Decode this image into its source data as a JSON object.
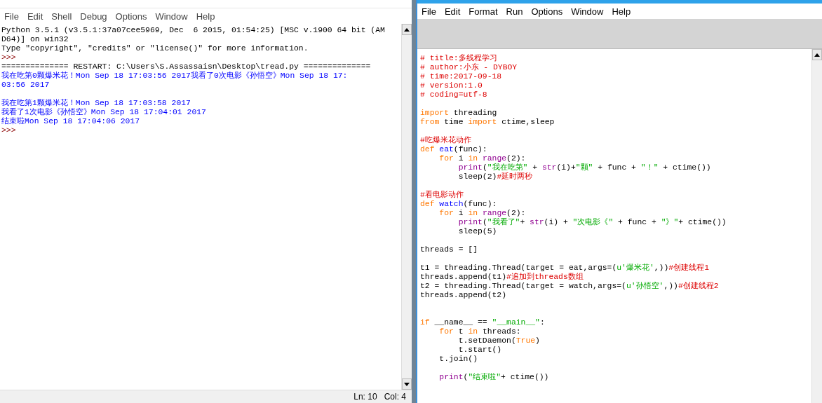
{
  "shell": {
    "menu": [
      "File",
      "Edit",
      "Shell",
      "Debug",
      "Options",
      "Window",
      "Help"
    ],
    "lines": [
      {
        "kind": "plain",
        "text": "Python 3.5.1 (v3.5.1:37a07cee5969, Dec  6 2015, 01:54:25) [MSC v.1900 64 bit (AM"
      },
      {
        "kind": "plain",
        "text": "D64)] on win32"
      },
      {
        "kind": "plain",
        "text": "Type \"copyright\", \"credits\" or \"license()\" for more information."
      },
      {
        "kind": "prompt",
        "text": ">>>"
      },
      {
        "kind": "plain",
        "text": "============== RESTART: C:\\Users\\S.Assassaisn\\Desktop\\tread.py =============="
      },
      {
        "kind": "stdout",
        "text": "我在吃第0颗爆米花！Mon Sep 18 17:03:56 2017我看了0次电影《孙悟空》Mon Sep 18 17:"
      },
      {
        "kind": "stdout",
        "text": "03:56 2017"
      },
      {
        "kind": "blank"
      },
      {
        "kind": "stdout",
        "text": "我在吃第1颗爆米花！Mon Sep 18 17:03:58 2017"
      },
      {
        "kind": "stdout",
        "text": "我看了1次电影《孙悟空》Mon Sep 18 17:04:01 2017"
      },
      {
        "kind": "stdout",
        "text": "结束啦Mon Sep 18 17:04:06 2017"
      },
      {
        "kind": "prompt",
        "text": ">>>"
      }
    ],
    "status_bar": {
      "line": "Ln: 10",
      "column": "Col: 4"
    }
  },
  "editor": {
    "menu": [
      "File",
      "Edit",
      "Format",
      "Run",
      "Options",
      "Window",
      "Help"
    ],
    "lines": [
      {
        "kind": "code",
        "tokens": [
          {
            "kind": "comment",
            "text": "# title:多线程学习"
          }
        ]
      },
      {
        "kind": "code",
        "tokens": [
          {
            "kind": "comment",
            "text": "# author:小东 - DYBOY"
          }
        ]
      },
      {
        "kind": "code",
        "tokens": [
          {
            "kind": "comment",
            "text": "# time:2017-09-18"
          }
        ]
      },
      {
        "kind": "code",
        "tokens": [
          {
            "kind": "comment",
            "text": "# version:1.0"
          }
        ]
      },
      {
        "kind": "code",
        "tokens": [
          {
            "kind": "comment",
            "text": "# coding=utf-8"
          }
        ]
      },
      {
        "kind": "blank"
      },
      {
        "kind": "code",
        "tokens": [
          {
            "kind": "keyword",
            "text": "import"
          },
          {
            "kind": "plain",
            "text": " threading"
          }
        ]
      },
      {
        "kind": "code",
        "tokens": [
          {
            "kind": "keyword",
            "text": "from"
          },
          {
            "kind": "plain",
            "text": " time "
          },
          {
            "kind": "keyword",
            "text": "import"
          },
          {
            "kind": "plain",
            "text": " ctime,sleep"
          }
        ]
      },
      {
        "kind": "blank"
      },
      {
        "kind": "code",
        "tokens": [
          {
            "kind": "comment",
            "text": "#吃爆米花动作"
          }
        ]
      },
      {
        "kind": "code",
        "tokens": [
          {
            "kind": "keyword",
            "text": "def "
          },
          {
            "kind": "definition",
            "text": "eat"
          },
          {
            "kind": "plain",
            "text": "(func):"
          }
        ]
      },
      {
        "kind": "code",
        "tokens": [
          {
            "kind": "keyword",
            "text": "    for"
          },
          {
            "kind": "plain",
            "text": " i "
          },
          {
            "kind": "keyword",
            "text": "in "
          },
          {
            "kind": "builtin",
            "text": "range"
          },
          {
            "kind": "plain",
            "text": "(2):"
          }
        ]
      },
      {
        "kind": "code",
        "tokens": [
          {
            "kind": "builtin",
            "text": "        print"
          },
          {
            "kind": "plain",
            "text": "("
          },
          {
            "kind": "string",
            "text": "\"我在吃第\""
          },
          {
            "kind": "plain",
            "text": " + "
          },
          {
            "kind": "builtin",
            "text": "str"
          },
          {
            "kind": "plain",
            "text": "(i)+"
          },
          {
            "kind": "string",
            "text": "\"颗\""
          },
          {
            "kind": "plain",
            "text": " + func + "
          },
          {
            "kind": "string",
            "text": "\"！\""
          },
          {
            "kind": "plain",
            "text": " + ctime())"
          }
        ]
      },
      {
        "kind": "code",
        "tokens": [
          {
            "kind": "plain",
            "text": "        sleep(2)"
          },
          {
            "kind": "comment",
            "text": "#延时两秒"
          }
        ]
      },
      {
        "kind": "blank"
      },
      {
        "kind": "code",
        "tokens": [
          {
            "kind": "comment",
            "text": "#看电影动作"
          }
        ]
      },
      {
        "kind": "code",
        "tokens": [
          {
            "kind": "keyword",
            "text": "def "
          },
          {
            "kind": "definition",
            "text": "watch"
          },
          {
            "kind": "plain",
            "text": "(func):"
          }
        ]
      },
      {
        "kind": "code",
        "tokens": [
          {
            "kind": "keyword",
            "text": "    for"
          },
          {
            "kind": "plain",
            "text": " i "
          },
          {
            "kind": "keyword",
            "text": "in "
          },
          {
            "kind": "builtin",
            "text": "range"
          },
          {
            "kind": "plain",
            "text": "(2):"
          }
        ]
      },
      {
        "kind": "code",
        "tokens": [
          {
            "kind": "builtin",
            "text": "        print"
          },
          {
            "kind": "plain",
            "text": "("
          },
          {
            "kind": "string",
            "text": "\"我看了\""
          },
          {
            "kind": "plain",
            "text": "+ "
          },
          {
            "kind": "builtin",
            "text": "str"
          },
          {
            "kind": "plain",
            "text": "(i) + "
          },
          {
            "kind": "string",
            "text": "\"次电影《\""
          },
          {
            "kind": "plain",
            "text": " + func + "
          },
          {
            "kind": "string",
            "text": "\"》\""
          },
          {
            "kind": "plain",
            "text": "+ ctime())"
          }
        ]
      },
      {
        "kind": "code",
        "tokens": [
          {
            "kind": "plain",
            "text": "        sleep(5)"
          }
        ]
      },
      {
        "kind": "blank"
      },
      {
        "kind": "code",
        "tokens": [
          {
            "kind": "plain",
            "text": "threads = []"
          }
        ]
      },
      {
        "kind": "blank"
      },
      {
        "kind": "code",
        "tokens": [
          {
            "kind": "plain",
            "text": "t1 = threading.Thread(target = eat,args=("
          },
          {
            "kind": "string",
            "text": "u'爆米花'"
          },
          {
            "kind": "plain",
            "text": ",))"
          },
          {
            "kind": "comment",
            "text": "#创建线程1"
          }
        ]
      },
      {
        "kind": "code",
        "tokens": [
          {
            "kind": "plain",
            "text": "threads.append(t1)"
          },
          {
            "kind": "comment",
            "text": "#追加到threads数组"
          }
        ]
      },
      {
        "kind": "code",
        "tokens": [
          {
            "kind": "plain",
            "text": "t2 = threading.Thread(target = watch,args=("
          },
          {
            "kind": "string",
            "text": "u'孙悟空'"
          },
          {
            "kind": "plain",
            "text": ",))"
          },
          {
            "kind": "comment",
            "text": "#创建线程2"
          }
        ]
      },
      {
        "kind": "code",
        "tokens": [
          {
            "kind": "plain",
            "text": "threads.append(t2)"
          }
        ]
      },
      {
        "kind": "blank"
      },
      {
        "kind": "blank"
      },
      {
        "kind": "code",
        "tokens": [
          {
            "kind": "keyword",
            "text": "if"
          },
          {
            "kind": "plain",
            "text": " __name__ == "
          },
          {
            "kind": "string",
            "text": "\"__main__\""
          },
          {
            "kind": "plain",
            "text": ":"
          }
        ]
      },
      {
        "kind": "code",
        "tokens": [
          {
            "kind": "keyword",
            "text": "    for"
          },
          {
            "kind": "plain",
            "text": " t "
          },
          {
            "kind": "keyword",
            "text": "in"
          },
          {
            "kind": "plain",
            "text": " threads:"
          }
        ]
      },
      {
        "kind": "code",
        "tokens": [
          {
            "kind": "plain",
            "text": "        t.setDaemon("
          },
          {
            "kind": "keyword",
            "text": "True"
          },
          {
            "kind": "plain",
            "text": ")"
          }
        ]
      },
      {
        "kind": "code",
        "tokens": [
          {
            "kind": "plain",
            "text": "        t.start()"
          }
        ]
      },
      {
        "kind": "code",
        "tokens": [
          {
            "kind": "plain",
            "text": "    t.join()"
          }
        ]
      },
      {
        "kind": "blank"
      },
      {
        "kind": "code",
        "tokens": [
          {
            "kind": "builtin",
            "text": "    print"
          },
          {
            "kind": "plain",
            "text": "("
          },
          {
            "kind": "string",
            "text": "\"结束啦\""
          },
          {
            "kind": "plain",
            "text": "+ ctime())"
          }
        ]
      }
    ]
  }
}
